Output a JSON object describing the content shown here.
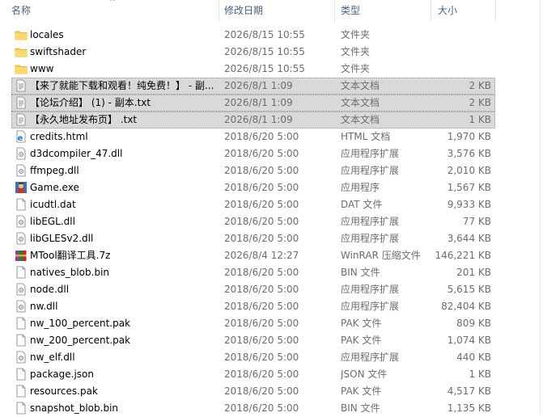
{
  "columns": {
    "name": "名称",
    "date": "修改日期",
    "type": "类型",
    "size": "大小"
  },
  "rows": [
    {
      "name": "locales",
      "date": "2026/8/15 10:55",
      "type": "文件夹",
      "size": "",
      "icon": "folder-icon",
      "selected": false
    },
    {
      "name": "swiftshader",
      "date": "2026/8/15 10:55",
      "type": "文件夹",
      "size": "",
      "icon": "folder-icon",
      "selected": false
    },
    {
      "name": "www",
      "date": "2026/8/15 10:55",
      "type": "文件夹",
      "size": "",
      "icon": "folder-icon",
      "selected": false
    },
    {
      "name": "【来了就能下载和观看！纯免费！】 - 副...",
      "date": "2026/8/1 1:09",
      "type": "文本文档",
      "size": "2 KB",
      "icon": "text-file-icon",
      "selected": true
    },
    {
      "name": "【论坛介绍】 (1) - 副本.txt",
      "date": "2026/8/1 1:09",
      "type": "文本文档",
      "size": "2 KB",
      "icon": "text-file-icon",
      "selected": true
    },
    {
      "name": "【永久地址发布页】 .txt",
      "date": "2026/8/1 1:09",
      "type": "文本文档",
      "size": "1 KB",
      "icon": "text-file-icon",
      "selected": true
    },
    {
      "name": "credits.html",
      "date": "2018/6/20 5:00",
      "type": "HTML 文档",
      "size": "1,970 KB",
      "icon": "html-file-icon",
      "selected": false
    },
    {
      "name": "d3dcompiler_47.dll",
      "date": "2018/6/20 5:00",
      "type": "应用程序扩展",
      "size": "3,576 KB",
      "icon": "dll-file-icon",
      "selected": false
    },
    {
      "name": "ffmpeg.dll",
      "date": "2018/6/20 5:00",
      "type": "应用程序扩展",
      "size": "2,010 KB",
      "icon": "dll-file-icon",
      "selected": false
    },
    {
      "name": "Game.exe",
      "date": "2018/6/20 5:00",
      "type": "应用程序",
      "size": "1,567 KB",
      "icon": "game-exe-icon",
      "selected": false
    },
    {
      "name": "icudtl.dat",
      "date": "2018/6/20 5:00",
      "type": "DAT 文件",
      "size": "9,933 KB",
      "icon": "blank-file-icon",
      "selected": false
    },
    {
      "name": "libEGL.dll",
      "date": "2018/6/20 5:00",
      "type": "应用程序扩展",
      "size": "77 KB",
      "icon": "dll-file-icon",
      "selected": false
    },
    {
      "name": "libGLESv2.dll",
      "date": "2018/6/20 5:00",
      "type": "应用程序扩展",
      "size": "3,644 KB",
      "icon": "dll-file-icon",
      "selected": false
    },
    {
      "name": "MTool翻译工具.7z",
      "date": "2026/8/4 12:27",
      "type": "WinRAR 压缩文件",
      "size": "146,221 KB",
      "icon": "winrar-archive-icon",
      "selected": false
    },
    {
      "name": "natives_blob.bin",
      "date": "2018/6/20 5:00",
      "type": "BIN 文件",
      "size": "201 KB",
      "icon": "blank-file-icon",
      "selected": false
    },
    {
      "name": "node.dll",
      "date": "2018/6/20 5:00",
      "type": "应用程序扩展",
      "size": "5,615 KB",
      "icon": "dll-file-icon",
      "selected": false
    },
    {
      "name": "nw.dll",
      "date": "2018/6/20 5:00",
      "type": "应用程序扩展",
      "size": "82,404 KB",
      "icon": "dll-file-icon",
      "selected": false
    },
    {
      "name": "nw_100_percent.pak",
      "date": "2018/6/20 5:00",
      "type": "PAK 文件",
      "size": "809 KB",
      "icon": "blank-file-icon",
      "selected": false
    },
    {
      "name": "nw_200_percent.pak",
      "date": "2018/6/20 5:00",
      "type": "PAK 文件",
      "size": "1,074 KB",
      "icon": "blank-file-icon",
      "selected": false
    },
    {
      "name": "nw_elf.dll",
      "date": "2018/6/20 5:00",
      "type": "应用程序扩展",
      "size": "440 KB",
      "icon": "dll-file-icon",
      "selected": false
    },
    {
      "name": "package.json",
      "date": "2018/6/20 5:00",
      "type": "JSON 文件",
      "size": "1 KB",
      "icon": "blank-file-icon",
      "selected": false
    },
    {
      "name": "resources.pak",
      "date": "2018/6/20 5:00",
      "type": "PAK 文件",
      "size": "4,517 KB",
      "icon": "blank-file-icon",
      "selected": false
    },
    {
      "name": "snapshot_blob.bin",
      "date": "2018/6/20 5:00",
      "type": "BIN 文件",
      "size": "1,135 KB",
      "icon": "blank-file-icon",
      "selected": false
    }
  ]
}
